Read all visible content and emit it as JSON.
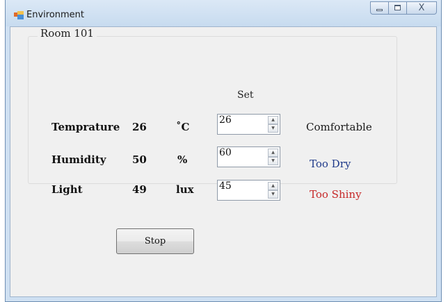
{
  "window": {
    "title": "Environment",
    "close_glyph": "X",
    "icons": [
      "app-icon",
      "minimize-icon",
      "maximize-icon",
      "close-icon"
    ]
  },
  "group": {
    "label": "Room 101"
  },
  "set_header": "Set",
  "rows": [
    {
      "label": "Temprature",
      "value": "26",
      "unit": "˚C",
      "setpoint": "26",
      "status": "Comfortable",
      "status_color": "#1a1a1a"
    },
    {
      "label": "Humidity",
      "value": "50",
      "unit": "%",
      "setpoint": "60",
      "status": "Too Dry",
      "status_color": "#1f3a8a"
    },
    {
      "label": "Light",
      "value": "49",
      "unit": "lux",
      "setpoint": "45",
      "status": "Too Shiny",
      "status_color": "#c62828"
    }
  ],
  "spin_glyphs": {
    "up": "▲",
    "down": "▼"
  },
  "buttons": {
    "stop": "Stop"
  }
}
